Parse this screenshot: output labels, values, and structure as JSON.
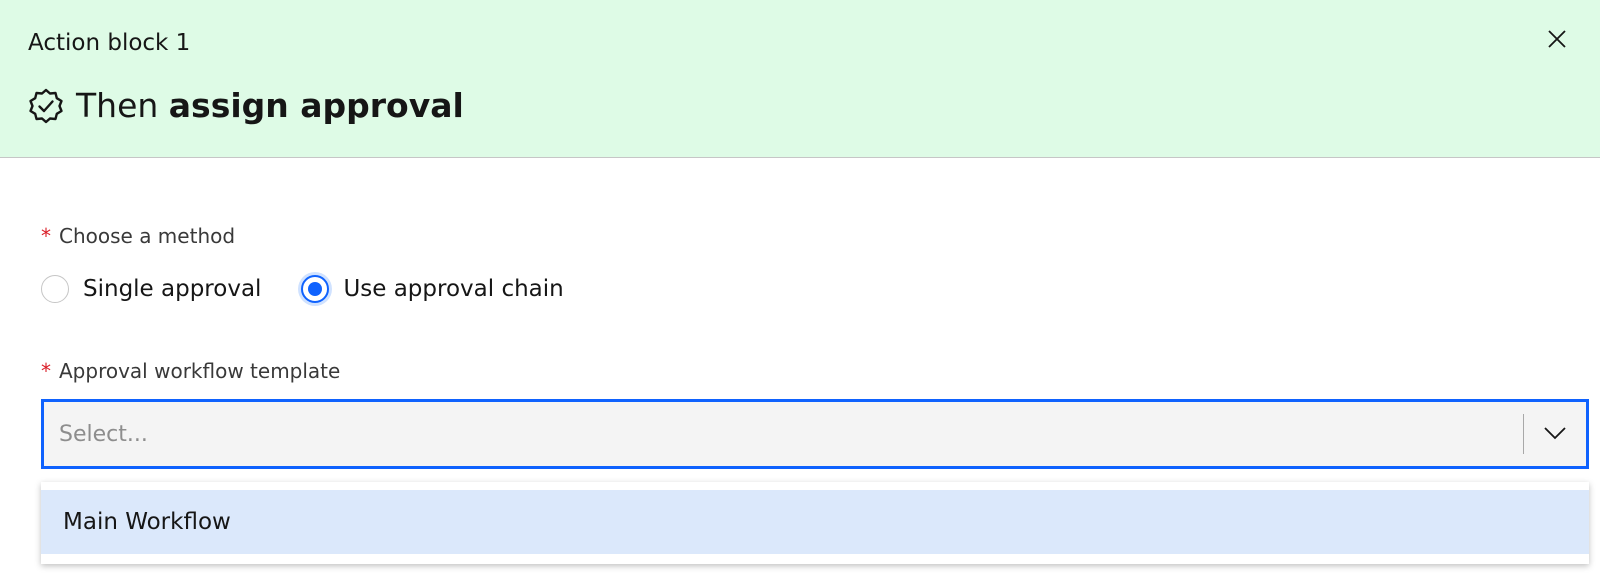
{
  "header": {
    "block_label": "Action block 1",
    "title_prefix": "Then ",
    "title_strong": "assign approval",
    "title_icon": "badge-check-icon",
    "close_icon": "close-icon",
    "background_color": "#defbe6"
  },
  "method_field": {
    "required_marker": "*",
    "label": "Choose a method",
    "options": [
      {
        "label": "Single approval",
        "selected": false
      },
      {
        "label": "Use approval chain",
        "selected": true
      }
    ]
  },
  "template_field": {
    "required_marker": "*",
    "label": "Approval workflow template",
    "value": "",
    "placeholder": "Select...",
    "chevron_icon": "chevron-down-icon"
  },
  "dropdown": {
    "items": [
      {
        "label": "Main Workflow",
        "highlighted": true
      }
    ]
  },
  "colors": {
    "accent": "#0f62fe",
    "required": "#da1e28",
    "highlight": "#dbe8fb"
  }
}
